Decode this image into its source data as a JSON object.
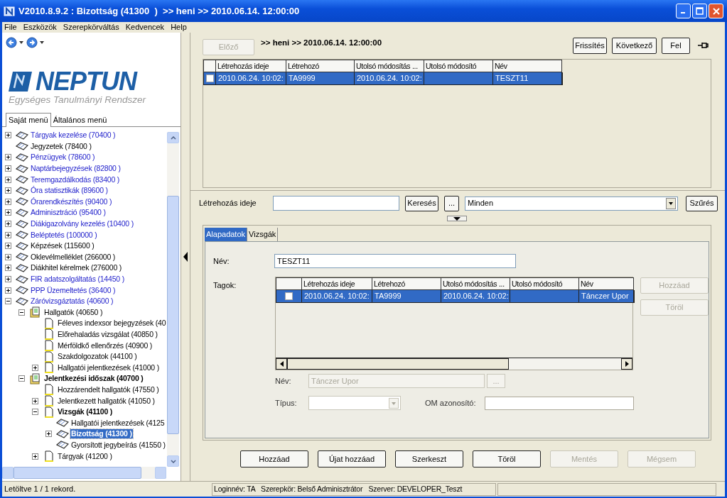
{
  "window": {
    "title": "V2010.8.9.2 : Bizottság (41300  )  >> heni >> 2010.06.14. 12:00:00"
  },
  "menu": [
    "File",
    "Eszközök",
    "Szerepkörváltás",
    "Kedvencek",
    "Help"
  ],
  "logo": {
    "name": "NEPTUN",
    "subtitle": "Egységes Tanulmányi Rendszer"
  },
  "menu_tabs": [
    {
      "label": "Saját menü",
      "selected": true
    },
    {
      "label": "Általános menü",
      "selected": false
    }
  ],
  "tree": [
    {
      "label": "Tárgyak kezelése (70400  )",
      "kind": "book",
      "expandable": true,
      "expanded": false,
      "link": true,
      "bold": false,
      "selected": false
    },
    {
      "label": "Jegyzetek (78400  )",
      "kind": "book",
      "expandable": false,
      "link": false,
      "bold": false,
      "selected": false
    },
    {
      "label": "Pénzügyek (78600  )",
      "kind": "book",
      "expandable": true,
      "expanded": false,
      "link": true,
      "bold": false,
      "selected": false
    },
    {
      "label": "Naptárbejegyzések (82800  )",
      "kind": "book",
      "expandable": true,
      "expanded": false,
      "link": true,
      "bold": false,
      "selected": false
    },
    {
      "label": "Teremgazdálkodás (83400  )",
      "kind": "book",
      "expandable": true,
      "expanded": false,
      "link": true,
      "bold": false,
      "selected": false
    },
    {
      "label": "Óra statisztikák (89600  )",
      "kind": "book",
      "expandable": true,
      "expanded": false,
      "link": true,
      "bold": false,
      "selected": false
    },
    {
      "label": "Órarendkészítés (90400  )",
      "kind": "book",
      "expandable": true,
      "expanded": false,
      "link": true,
      "bold": false,
      "selected": false
    },
    {
      "label": "Adminisztráció (95400  )",
      "kind": "book",
      "expandable": true,
      "expanded": false,
      "link": true,
      "bold": false,
      "selected": false
    },
    {
      "label": "Diákigazolvány kezelés (10400  )",
      "kind": "book",
      "expandable": true,
      "expanded": false,
      "link": true,
      "bold": false,
      "selected": false
    },
    {
      "label": "Beléptetés (100000  )",
      "kind": "book",
      "expandable": true,
      "expanded": false,
      "link": true,
      "bold": false,
      "selected": false
    },
    {
      "label": "Képzések (115600  )",
      "kind": "book",
      "expandable": true,
      "expanded": false,
      "link": false,
      "bold": false,
      "selected": false
    },
    {
      "label": "Oklevélmelléklet (266000  )",
      "kind": "book",
      "expandable": true,
      "expanded": false,
      "link": false,
      "bold": false,
      "selected": false
    },
    {
      "label": "Diákhitel kérelmek (276000  )",
      "kind": "book",
      "expandable": true,
      "expanded": false,
      "link": false,
      "bold": false,
      "selected": false
    },
    {
      "label": "FIR adatszolgáltatás (14450  )",
      "kind": "book",
      "expandable": true,
      "expanded": false,
      "link": true,
      "bold": false,
      "selected": false
    },
    {
      "label": "PPP Üzemeltetés (36400  )",
      "kind": "book",
      "expandable": true,
      "expanded": false,
      "link": true,
      "bold": false,
      "selected": false
    },
    {
      "label": "Záróvizsgáztatás (40600  )",
      "kind": "book",
      "expandable": true,
      "expanded": true,
      "link": true,
      "bold": false,
      "selected": false,
      "children": [
        {
          "label": "Hallgatók (40650  )",
          "kind": "folder",
          "expandable": true,
          "expanded": true,
          "link": false,
          "bold": false,
          "selected": false,
          "children": [
            {
              "label": "Féleves indexsor bejegyzések (40",
              "kind": "page",
              "expandable": false,
              "link": false,
              "bold": false,
              "selected": false
            },
            {
              "label": "Előrehaladás vizsgálat (40850  )",
              "kind": "page",
              "expandable": false,
              "link": false,
              "bold": false,
              "selected": false
            },
            {
              "label": "Mérföldkő ellenőrzés (40900  )",
              "kind": "page",
              "expandable": false,
              "link": false,
              "bold": false,
              "selected": false
            },
            {
              "label": "Szakdolgozatok (44100  )",
              "kind": "page",
              "expandable": false,
              "link": false,
              "bold": false,
              "selected": false
            },
            {
              "label": "Hallgatói jelentkezések (41000  )",
              "kind": "page",
              "expandable": true,
              "expanded": false,
              "link": false,
              "bold": false,
              "selected": false
            }
          ]
        },
        {
          "label": "Jelentkezési időszak (40700  )",
          "kind": "folder",
          "expandable": true,
          "expanded": true,
          "link": false,
          "bold": true,
          "selected": false,
          "children": [
            {
              "label": "Hozzárendelt hallgatók (47550  )",
              "kind": "page",
              "expandable": false,
              "link": false,
              "bold": false,
              "selected": false
            },
            {
              "label": "Jelentkezett hallgatók (41050  )",
              "kind": "page",
              "expandable": true,
              "expanded": false,
              "link": false,
              "bold": false,
              "selected": false
            },
            {
              "label": "Vizsgák (41100  )",
              "kind": "page",
              "expandable": true,
              "expanded": true,
              "link": false,
              "bold": true,
              "selected": false,
              "children": [
                {
                  "label": "Hallgatói jelentkezések (4125",
                  "kind": "book",
                  "expandable": false,
                  "link": false,
                  "bold": false,
                  "selected": false
                },
                {
                  "label": "Bizottság (41300  )",
                  "kind": "book",
                  "expandable": true,
                  "expanded": false,
                  "link": false,
                  "bold": true,
                  "selected": true
                },
                {
                  "label": "Gyorsított jegybeírás (41550  )",
                  "kind": "book",
                  "expandable": false,
                  "link": false,
                  "bold": false,
                  "selected": false
                }
              ]
            },
            {
              "label": "Tárgyak (41200  )",
              "kind": "page",
              "expandable": true,
              "expanded": false,
              "link": false,
              "bold": false,
              "selected": false
            }
          ]
        }
      ]
    }
  ],
  "header": {
    "prev_button": {
      "label": "Előző",
      "disabled": true
    },
    "title": ">> heni >> 2010.06.14. 12:00:00",
    "buttons": [
      {
        "label": "Frissítés",
        "disabled": false
      },
      {
        "label": "Következő",
        "disabled": false
      },
      {
        "label": "Fel",
        "disabled": false
      }
    ]
  },
  "top_grid": {
    "columns": [
      "Létrehozás ideje",
      "Létrehozó",
      "Utolsó módosítás ...",
      "Utolsó módosító",
      "Név"
    ],
    "rows": [
      {
        "selected": true,
        "checked": false,
        "cells": [
          "2010.06.24. 10:02:",
          "TA9999",
          "2010.06.24. 10:02:",
          "",
          "TESZT11"
        ]
      }
    ]
  },
  "filter": {
    "label": "Létrehozás ideje",
    "search_button": "Keresés",
    "more_button": "...",
    "dropdown": "Minden",
    "filter_button": "Szűrés"
  },
  "detail_tabs": [
    {
      "label": "Alapadatok",
      "selected": true
    },
    {
      "label": "Vizsgák",
      "selected": false
    }
  ],
  "detail": {
    "name_label": "Név:",
    "name_value": "TESZT11",
    "members_label": "Tagok:",
    "members_grid": {
      "columns": [
        "Létrehozás ideje",
        "Létrehozó",
        "Utolsó módosítás ...",
        "Utolsó módosító",
        "Név"
      ],
      "rows": [
        {
          "selected": true,
          "checked": false,
          "cells": [
            "2010.06.24. 10:02:",
            "TA9999",
            "2010.06.24. 10:02:",
            "",
            "Tánczer Upor"
          ]
        }
      ]
    },
    "side_buttons": [
      {
        "label": "Hozzáad",
        "disabled": true
      },
      {
        "label": "Töröl",
        "disabled": true
      }
    ],
    "member_name_label": "Név:",
    "member_name_value": "Tánczer Upor",
    "member_name_disabled": true,
    "member_more_button": "...",
    "type_label": "Típus:",
    "om_label": "OM azonosító:"
  },
  "actions": [
    {
      "label": "Hozzáad",
      "disabled": false
    },
    {
      "label": "Újat hozzáad",
      "disabled": false
    },
    {
      "label": "Szerkeszt",
      "disabled": false
    },
    {
      "label": "Töröl",
      "disabled": false
    },
    {
      "label": "Mentés",
      "disabled": true
    },
    {
      "label": "Mégsem",
      "disabled": true
    }
  ],
  "status_bar": {
    "left": "Letöltve 1 / 1 rekord.",
    "info": "Loginnév: TA   Szerepkör: Belső Adminisztrátor   Szerver: DEVELOPER_Teszt"
  }
}
